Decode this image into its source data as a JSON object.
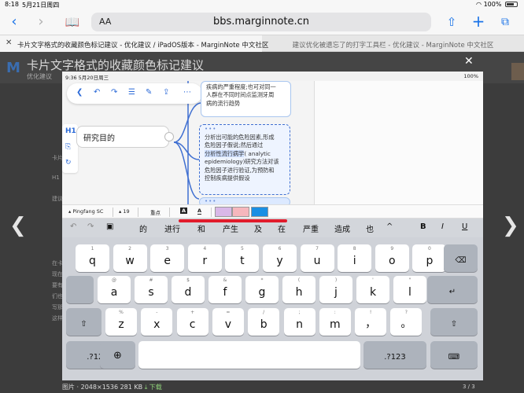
{
  "status_bar": {
    "time": "8:18",
    "date": "5月21日周四",
    "battery": "100%"
  },
  "safari": {
    "aa_label": "AA",
    "url": "bbs.marginnote.cn"
  },
  "tabs": [
    {
      "label": "卡片文字格式的收藏颜色标记建议 - 优化建议 / iPadOS版本 - MarginNote 中文社区"
    },
    {
      "label": "建议优化被遗忘了的打字工具栏 - 优化建议 - MarginNote 中文社区"
    }
  ],
  "background": {
    "title": "卡片文字格式的收藏颜色标记建议",
    "sub": "优化建议",
    "side_texts": [
      "卡片",
      "H1",
      "建议",
      "在卡片",
      "现在卡",
      "要有一",
      "们也可",
      "写那里",
      "这样都"
    ]
  },
  "inner": {
    "status_time": "9:36  5月20日周三",
    "status_right": "100%",
    "node_label": "研究目的",
    "card1_lines": [
      "疾病的严重程度;也可对同一",
      "人群在不同时间点监测牙周",
      "病的流行趋势"
    ],
    "card2_lines_a": [
      "分析出可能的危险因素,形成",
      "危险因子假说;然后通过"
    ],
    "card2_highlight": "分析性流行病学",
    "card2_after_hl": "( analytic",
    "card2_lines_b": [
      "epidemiology)研究方法对该",
      "危险因子进行验证,为预防和",
      "控制疾病提供假设"
    ],
    "h1_label": "H1"
  },
  "format_bar": {
    "font": "Pingfang SC",
    "size": "19",
    "focus": "重点",
    "text_a": "A",
    "swatch_colors": [
      "#d9b8e8",
      "#f6b7bd",
      "#1a8fe3"
    ]
  },
  "keyboard": {
    "suggestions": [
      "的",
      "进行",
      "和",
      "产生",
      "及",
      "在",
      "严重",
      "造成",
      "也"
    ],
    "bold": "B",
    "italic": "I",
    "underline": "U",
    "row1": [
      {
        "s": "1",
        "m": "q"
      },
      {
        "s": "2",
        "m": "w"
      },
      {
        "s": "3",
        "m": "e"
      },
      {
        "s": "4",
        "m": "r"
      },
      {
        "s": "5",
        "m": "t"
      },
      {
        "s": "6",
        "m": "y"
      },
      {
        "s": "7",
        "m": "u"
      },
      {
        "s": "8",
        "m": "i"
      },
      {
        "s": "9",
        "m": "o"
      },
      {
        "s": "0",
        "m": "p"
      }
    ],
    "row2": [
      {
        "s": "@",
        "m": "a"
      },
      {
        "s": "#",
        "m": "s"
      },
      {
        "s": "$",
        "m": "d"
      },
      {
        "s": "&",
        "m": "f"
      },
      {
        "s": "*",
        "m": "g"
      },
      {
        "s": "(",
        "m": "h"
      },
      {
        "s": ")",
        "m": "j"
      },
      {
        "s": "'",
        "m": "k"
      },
      {
        "s": "\"",
        "m": "l"
      }
    ],
    "row3": [
      {
        "s": "%",
        "m": "z"
      },
      {
        "s": "-",
        "m": "x"
      },
      {
        "s": "+",
        "m": "c"
      },
      {
        "s": "=",
        "m": "v"
      },
      {
        "s": "/",
        "m": "b"
      },
      {
        "s": ";",
        "m": "n"
      },
      {
        "s": ":",
        "m": "m"
      },
      {
        "s": "!",
        "m": "，"
      },
      {
        "s": "?",
        "m": "。"
      }
    ],
    "numbers_label": ".?123"
  },
  "caption": {
    "text": "图片 · 2048×1536 281 KB",
    "download": "下载",
    "page": "3 / 3"
  }
}
